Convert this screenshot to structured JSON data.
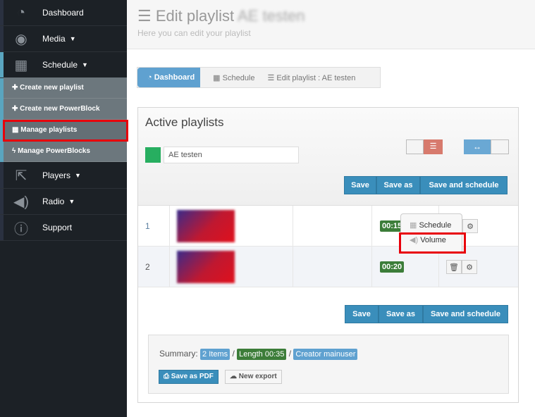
{
  "sidebar": {
    "items": [
      {
        "label": "Dashboard",
        "icon": "dashboard-icon"
      },
      {
        "label": "Media",
        "icon": "eye-icon"
      },
      {
        "label": "Schedule",
        "icon": "calendar-icon"
      },
      {
        "label": "Players",
        "icon": "external-link-icon"
      },
      {
        "label": "Radio",
        "icon": "volume-icon"
      },
      {
        "label": "Support",
        "icon": "info-icon"
      }
    ],
    "submenu": [
      "Create new playlist",
      "Create new PowerBlock",
      "Manage playlists",
      "Manage PowerBlocks"
    ]
  },
  "header": {
    "title": "Edit playlist",
    "playlist_name": "AE testen",
    "subtitle": "Here you can edit your playlist"
  },
  "breadcrumb": [
    "Dashboard",
    "Schedule",
    "Edit playlist : AE testen"
  ],
  "panel": {
    "title": "Active playlists",
    "name_value": "AE testen",
    "color": "#27ae60",
    "buttons": {
      "save": "Save",
      "save_as": "Save as",
      "save_schedule": "Save and schedule"
    },
    "rows": [
      {
        "index": "1",
        "duration": "00:15"
      },
      {
        "index": "2",
        "duration": "00:20"
      }
    ],
    "menu": {
      "schedule": "Schedule",
      "volume": "Volume"
    },
    "summary": {
      "label": "Summary:",
      "items": "2 Items",
      "length": "Length 00:35",
      "creator": "Creator mainuser",
      "sep": "/"
    },
    "save_pdf": "Save as PDF",
    "new_export": "New export"
  }
}
